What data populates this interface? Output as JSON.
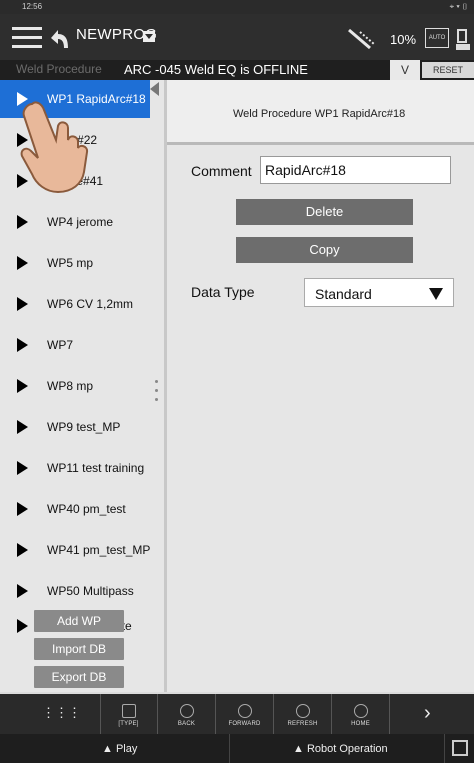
{
  "status_bar": {
    "time": "12:56",
    "right_icons": "⌖ ▾ ▯"
  },
  "toolbar": {
    "program_name": "NEWPROG",
    "speed": "10%",
    "auto_label": "AUTO"
  },
  "weld_bar": {
    "label": "Weld Procedure",
    "status": "ARC -045 Weld EQ is OFFLINE",
    "dropdown": "V",
    "reset_label": "RESET"
  },
  "weld_procedures": [
    "WP1 RapidArc#18",
    "Pulse#22",
    "sPulse#41",
    "WP4 jerome",
    "WP5 mp",
    "WP6 CV 1,2mm",
    "WP7",
    "WP8 mp",
    "WP9 test_MP",
    "WP11 test training",
    "WP40 pm_test",
    "WP41 pm_test_MP",
    "WP50 Multipass",
    "WP51 Charlatte"
  ],
  "side_buttons": {
    "add": "Add WP",
    "import": "Import DB",
    "export": "Export DB"
  },
  "detail": {
    "header": "Weld Procedure  WP1 RapidArc#18",
    "comment_label": "Comment",
    "comment_value": "RapidArc#18",
    "delete_label": "Delete",
    "copy_label": "Copy",
    "datatype_label": "Data Type",
    "datatype_value": "Standard"
  },
  "bottom_nav": {
    "type": "[TYPE]",
    "back": "BACK",
    "forward": "FORWARD",
    "refresh": "REFRESH",
    "home": "HOME"
  },
  "footer": {
    "play": "▲ Play",
    "robot": "▲ Robot Operation"
  }
}
